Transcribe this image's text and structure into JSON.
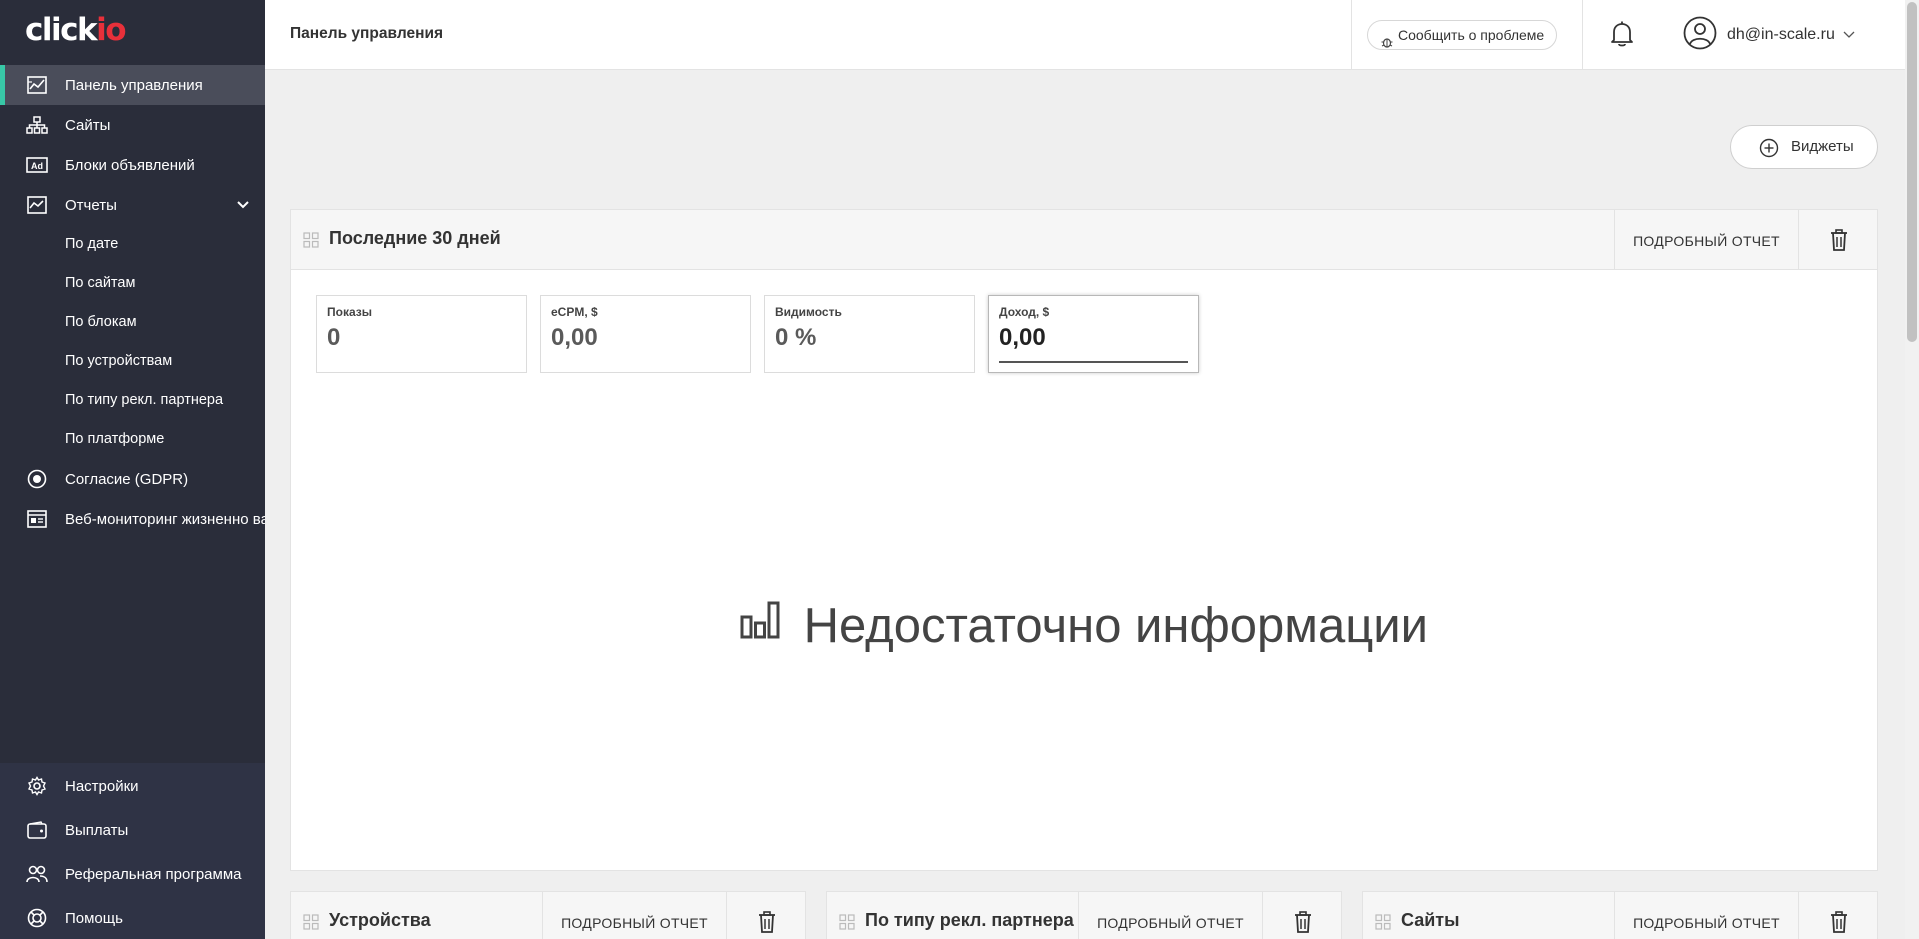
{
  "app": {
    "logo_prefix": "click",
    "logo_suffix": "io",
    "page_title": "Панель управления"
  },
  "sidebar": {
    "items": [
      {
        "label": "Панель управления",
        "icon": "chart-line-icon"
      },
      {
        "label": "Сайты",
        "icon": "sitemap-icon"
      },
      {
        "label": "Блоки объявлений",
        "icon": "ad-icon"
      },
      {
        "label": "Отчеты",
        "icon": "report-icon"
      },
      {
        "label": "Согласие (GDPR)",
        "icon": "consent-icon"
      },
      {
        "label": "Веб-мониторинг жизненно важных показателей",
        "icon": "monitoring-icon"
      }
    ],
    "reports_sub": [
      "По дате",
      "По сайтам",
      "По блокам",
      "По устройствам",
      "По типу рекл. партнера",
      "По платформе"
    ],
    "bottom": [
      {
        "label": "Настройки",
        "icon": "gear-icon"
      },
      {
        "label": "Выплаты",
        "icon": "wallet-icon"
      },
      {
        "label": "Реферальная программа",
        "icon": "users-icon"
      },
      {
        "label": "Помощь",
        "icon": "lifebuoy-icon"
      }
    ]
  },
  "header": {
    "report_problem": "Сообщить о проблеме",
    "user_email": "dh@in-scale.ru"
  },
  "widgets_button": "Виджеты",
  "main_card": {
    "title": "Последние 30 дней",
    "detail": "ПОДРОБНЫЙ ОТЧЕТ",
    "metrics": [
      {
        "label": "Показы",
        "value": "0"
      },
      {
        "label": "eCPM, $",
        "value": "0,00"
      },
      {
        "label": "Видимость",
        "value": "0 %"
      },
      {
        "label": "Доход, $",
        "value": "0,00"
      }
    ],
    "selected_metric": "Доход, $",
    "empty_text": "Недостаточно информации"
  },
  "bottom_cards": [
    {
      "title": "Устройства",
      "detail": "ПОДРОБНЫЙ ОТЧЕТ"
    },
    {
      "title": "По типу рекл. партнера",
      "detail": "ПОДРОБНЫЙ ОТЧЕТ"
    },
    {
      "title": "Сайты",
      "detail": "ПОДРОБНЫЙ ОТЧЕТ"
    }
  ],
  "colors": {
    "sidebar_bg": "#2a2d3a",
    "active_accent": "#38c7a6",
    "logo_accent": "#e8303a"
  }
}
